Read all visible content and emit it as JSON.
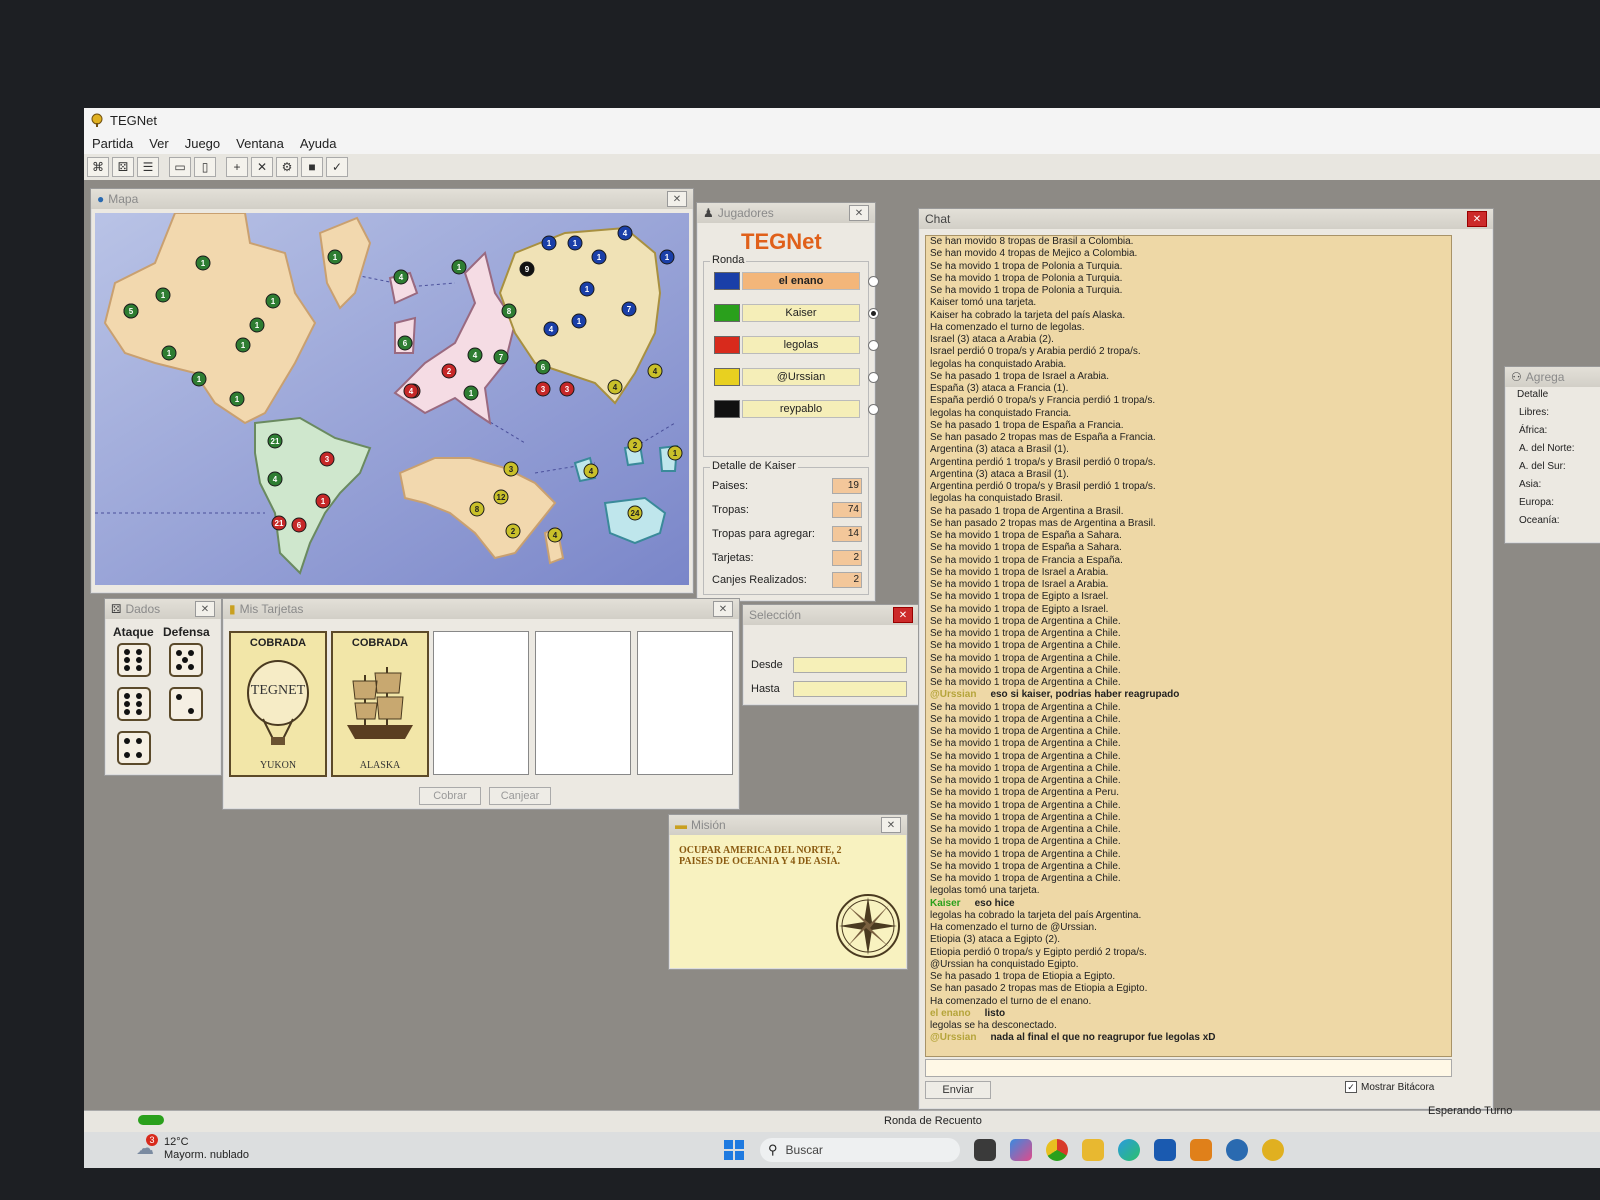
{
  "app": {
    "title": "TEGNet"
  },
  "menu": [
    "Partida",
    "Ver",
    "Juego",
    "Ventana",
    "Ayuda"
  ],
  "toolbar_icons": [
    "connect-icon",
    "dice-icon",
    "list-icon",
    "card-icon",
    "mission-icon",
    "add-icon",
    "remove-icon",
    "gear-icon",
    "stack-icon",
    "check-icon"
  ],
  "map_window": {
    "title": "Mapa"
  },
  "territories": [
    {
      "color": "#2e7d32",
      "n": "1"
    },
    {
      "color": "#2e7d32",
      "n": "1"
    },
    {
      "color": "#2e7d32",
      "n": "1"
    },
    {
      "color": "#2e7d32",
      "n": "5"
    },
    {
      "color": "#2e7d32",
      "n": "1"
    },
    {
      "color": "#2e7d32",
      "n": "1"
    },
    {
      "color": "#2e7d32",
      "n": "1"
    },
    {
      "color": "#2e7d32",
      "n": "1"
    },
    {
      "color": "#2e7d32",
      "n": "1"
    },
    {
      "color": "#2e7d32",
      "n": "1"
    },
    {
      "color": "#2e7d32",
      "n": "1"
    },
    {
      "color": "#2e7d32",
      "n": "4"
    },
    {
      "color": "#2e7d32",
      "n": "1"
    },
    {
      "color": "#2e7d32",
      "n": "6"
    },
    {
      "color": "#2e7d32",
      "n": "8"
    },
    {
      "color": "#2e7d32",
      "n": "4"
    },
    {
      "color": "#2e7d32",
      "n": "7"
    },
    {
      "color": "#2e7d32",
      "n": "1"
    },
    {
      "color": "#2e7d32",
      "n": "6"
    },
    {
      "color": "#2e7d32",
      "n": "21"
    },
    {
      "color": "#2e7d32",
      "n": "4"
    },
    {
      "color": "#c62828",
      "n": "3"
    },
    {
      "color": "#c62828",
      "n": "1"
    },
    {
      "color": "#c62828",
      "n": "21"
    },
    {
      "color": "#c62828",
      "n": "6"
    },
    {
      "color": "#c62828",
      "n": "4"
    },
    {
      "color": "#c62828",
      "n": "2"
    },
    {
      "color": "#c62828",
      "n": "4"
    },
    {
      "color": "#c62828",
      "n": "3"
    },
    {
      "color": "#c62828",
      "n": "3"
    },
    {
      "color": "#1a3fa8",
      "n": "1"
    },
    {
      "color": "#1a3fa8",
      "n": "1"
    },
    {
      "color": "#1a3fa8",
      "n": "4"
    },
    {
      "color": "#1a3fa8",
      "n": "1"
    },
    {
      "color": "#1a3fa8",
      "n": "1"
    },
    {
      "color": "#1a3fa8",
      "n": "1"
    },
    {
      "color": "#1a3fa8",
      "n": "4"
    },
    {
      "color": "#1a3fa8",
      "n": "1"
    },
    {
      "color": "#1a3fa8",
      "n": "7"
    },
    {
      "color": "#111111",
      "n": "9"
    },
    {
      "color": "#c9c02a",
      "n": "4"
    },
    {
      "color": "#c9c02a",
      "n": "4"
    },
    {
      "color": "#c9c02a",
      "n": "3"
    },
    {
      "color": "#c9c02a",
      "n": "12"
    },
    {
      "color": "#c9c02a",
      "n": "8"
    },
    {
      "color": "#c9c02a",
      "n": "2"
    },
    {
      "color": "#c9c02a",
      "n": "4"
    },
    {
      "color": "#c9c02a",
      "n": "4"
    },
    {
      "color": "#c9c02a",
      "n": "2"
    },
    {
      "color": "#c9c02a",
      "n": "1"
    },
    {
      "color": "#c9c02a",
      "n": "24"
    }
  ],
  "players_window": {
    "title": "Jugadores",
    "logo": "TEGNet",
    "group": "Ronda",
    "players": [
      {
        "name": "el enano",
        "color": "#1a3fa8",
        "active": true,
        "selected": false
      },
      {
        "name": "Kaiser",
        "color": "#2aa01c",
        "active": false,
        "selected": true
      },
      {
        "name": "legolas",
        "color": "#d82a1c",
        "active": false,
        "selected": false
      },
      {
        "name": "@Urssian",
        "color": "#e8d020",
        "active": false,
        "selected": false
      },
      {
        "name": "reypablo",
        "color": "#111111",
        "active": false,
        "selected": false
      }
    ],
    "detail": {
      "label": "Detalle de Kaiser",
      "rows": [
        {
          "label": "Paises:",
          "value": "19"
        },
        {
          "label": "Tropas:",
          "value": "74"
        },
        {
          "label": "Tropas para agregar:",
          "value": "14"
        },
        {
          "label": "Tarjetas:",
          "value": "2"
        },
        {
          "label": "Canjes Realizados:",
          "value": "2"
        }
      ]
    }
  },
  "dice_window": {
    "title": "Dados",
    "attack_label": "Ataque",
    "defense_label": "Defensa",
    "attack": [
      6,
      6,
      4
    ],
    "defense": [
      5,
      2
    ]
  },
  "cards_window": {
    "title": "Mis Tarjetas",
    "cards": [
      {
        "header": "COBRADA",
        "image": "TEGNET",
        "name": "YUKON"
      },
      {
        "header": "COBRADA",
        "image": "",
        "name": "ALASKA"
      }
    ],
    "collect_button": "Cobrar",
    "exchange_button": "Canjear"
  },
  "selection_window": {
    "title": "Selección",
    "from_label": "Desde",
    "to_label": "Hasta"
  },
  "mission_window": {
    "title": "Misión",
    "text": "OCUPAR AMERICA DEL NORTE, 2 PAISES DE OCEANIA Y 4 DE ASIA."
  },
  "chat_window": {
    "title": "Chat",
    "lines": [
      {
        "who": "",
        "text": "Se han movido 8 tropas de Brasil a Colombia."
      },
      {
        "who": "",
        "text": "Se han movido 4 tropas de Mejico a Colombia."
      },
      {
        "who": "",
        "text": "Se ha movido 1 tropa de Polonia a Turquia."
      },
      {
        "who": "",
        "text": "Se ha movido 1 tropa de Polonia a Turquia."
      },
      {
        "who": "",
        "text": "Se ha movido 1 tropa de Polonia a Turquia."
      },
      {
        "who": "",
        "text": "Kaiser tomó una tarjeta."
      },
      {
        "who": "",
        "text": "Kaiser ha cobrado la tarjeta del país Alaska."
      },
      {
        "who": "",
        "text": "Ha comenzado el turno de legolas."
      },
      {
        "who": "",
        "text": "Israel (3) ataca a Arabia (2)."
      },
      {
        "who": "",
        "text": "Israel perdió 0 tropa/s y Arabia perdió 2 tropa/s."
      },
      {
        "who": "",
        "text": "legolas ha conquistado Arabia."
      },
      {
        "who": "",
        "text": "Se ha pasado 1 tropa de Israel a Arabia."
      },
      {
        "who": "",
        "text": "España (3) ataca a Francia (1)."
      },
      {
        "who": "",
        "text": "España perdió 0 tropa/s y Francia perdió 1 tropa/s."
      },
      {
        "who": "",
        "text": "legolas ha conquistado Francia."
      },
      {
        "who": "",
        "text": "Se ha pasado 1 tropa de España a Francia."
      },
      {
        "who": "",
        "text": "Se han pasado 2 tropas mas de España a Francia."
      },
      {
        "who": "",
        "text": "Argentina (3) ataca a Brasil (1)."
      },
      {
        "who": "",
        "text": "Argentina perdió 1 tropa/s y Brasil perdió 0 tropa/s."
      },
      {
        "who": "",
        "text": "Argentina (3) ataca a Brasil (1)."
      },
      {
        "who": "",
        "text": "Argentina perdió 0 tropa/s y Brasil perdió 1 tropa/s."
      },
      {
        "who": "",
        "text": "legolas ha conquistado Brasil."
      },
      {
        "who": "",
        "text": "Se ha pasado 1 tropa de Argentina a Brasil."
      },
      {
        "who": "",
        "text": "Se han pasado 2 tropas mas de Argentina a Brasil."
      },
      {
        "who": "",
        "text": "Se ha movido 1 tropa de España a Sahara."
      },
      {
        "who": "",
        "text": "Se ha movido 1 tropa de España a Sahara."
      },
      {
        "who": "",
        "text": "Se ha movido 1 tropa de Francia a España."
      },
      {
        "who": "",
        "text": "Se ha movido 1 tropa de Israel a Arabia."
      },
      {
        "who": "",
        "text": "Se ha movido 1 tropa de Israel a Arabia."
      },
      {
        "who": "",
        "text": "Se ha movido 1 tropa de Egipto a Israel."
      },
      {
        "who": "",
        "text": "Se ha movido 1 tropa de Egipto a Israel."
      },
      {
        "who": "",
        "text": "Se ha movido 1 tropa de Argentina a Chile."
      },
      {
        "who": "",
        "text": "Se ha movido 1 tropa de Argentina a Chile."
      },
      {
        "who": "",
        "text": "Se ha movido 1 tropa de Argentina a Chile."
      },
      {
        "who": "",
        "text": "Se ha movido 1 tropa de Argentina a Chile."
      },
      {
        "who": "",
        "text": "Se ha movido 1 tropa de Argentina a Chile."
      },
      {
        "who": "",
        "text": "Se ha movido 1 tropa de Argentina a Chile."
      },
      {
        "who": "@Urssian",
        "text": "eso si kaiser, podrias haber reagrupado",
        "msg": true
      },
      {
        "who": "",
        "text": "Se ha movido 1 tropa de Argentina a Chile."
      },
      {
        "who": "",
        "text": "Se ha movido 1 tropa de Argentina a Chile."
      },
      {
        "who": "",
        "text": "Se ha movido 1 tropa de Argentina a Chile."
      },
      {
        "who": "",
        "text": "Se ha movido 1 tropa de Argentina a Chile."
      },
      {
        "who": "",
        "text": "Se ha movido 1 tropa de Argentina a Chile."
      },
      {
        "who": "",
        "text": "Se ha movido 1 tropa de Argentina a Chile."
      },
      {
        "who": "",
        "text": "Se ha movido 1 tropa de Argentina a Chile."
      },
      {
        "who": "",
        "text": "Se ha movido 1 tropa de Argentina a Peru."
      },
      {
        "who": "",
        "text": "Se ha movido 1 tropa de Argentina a Chile."
      },
      {
        "who": "",
        "text": "Se ha movido 1 tropa de Argentina a Chile."
      },
      {
        "who": "",
        "text": "Se ha movido 1 tropa de Argentina a Chile."
      },
      {
        "who": "",
        "text": "Se ha movido 1 tropa de Argentina a Chile."
      },
      {
        "who": "",
        "text": "Se ha movido 1 tropa de Argentina a Chile."
      },
      {
        "who": "",
        "text": "Se ha movido 1 tropa de Argentina a Chile."
      },
      {
        "who": "",
        "text": "Se ha movido 1 tropa de Argentina a Chile."
      },
      {
        "who": "",
        "text": "legolas tomó una tarjeta."
      },
      {
        "who": "Kaiser",
        "text": "eso hice",
        "msg": true,
        "green": true
      },
      {
        "who": "",
        "text": "legolas ha cobrado la tarjeta del país Argentina."
      },
      {
        "who": "",
        "text": "Ha comenzado el turno de @Urssian."
      },
      {
        "who": "",
        "text": "Etiopia (3) ataca a Egipto (2)."
      },
      {
        "who": "",
        "text": "Etiopia perdió 0 tropa/s y Egipto perdió 2 tropa/s."
      },
      {
        "who": "",
        "text": "@Urssian ha conquistado Egipto."
      },
      {
        "who": "",
        "text": "Se ha pasado 1 tropa de Etiopia a Egipto."
      },
      {
        "who": "",
        "text": "Se han pasado 2 tropas mas de Etiopia a Egipto."
      },
      {
        "who": "",
        "text": "Ha comenzado el turno de el enano."
      },
      {
        "who": "el enano",
        "text": "listo",
        "msg": true
      },
      {
        "who": "",
        "text": "legolas se ha desconectado."
      },
      {
        "who": "@Urssian",
        "text": "nada al final el que no reagrupor fue legolas xD",
        "msg": true
      }
    ],
    "send_button": "Enviar",
    "show_log_label": "Mostrar Bitácora",
    "show_log_checked": true
  },
  "add_panel": {
    "title": "Agrega",
    "detail_label": "Detalle",
    "rows": [
      "Libres:",
      "África:",
      "A. del Norte:",
      "A. del Sur:",
      "Asia:",
      "Europa:",
      "Oceanía:"
    ]
  },
  "statusbar": {
    "center": "Ronda de Recuento",
    "right": "Esperando Turno"
  },
  "taskbar": {
    "weather_temp": "12°C",
    "weather_desc": "Mayorm. nublado",
    "weather_badge": "3",
    "search": "Buscar"
  }
}
